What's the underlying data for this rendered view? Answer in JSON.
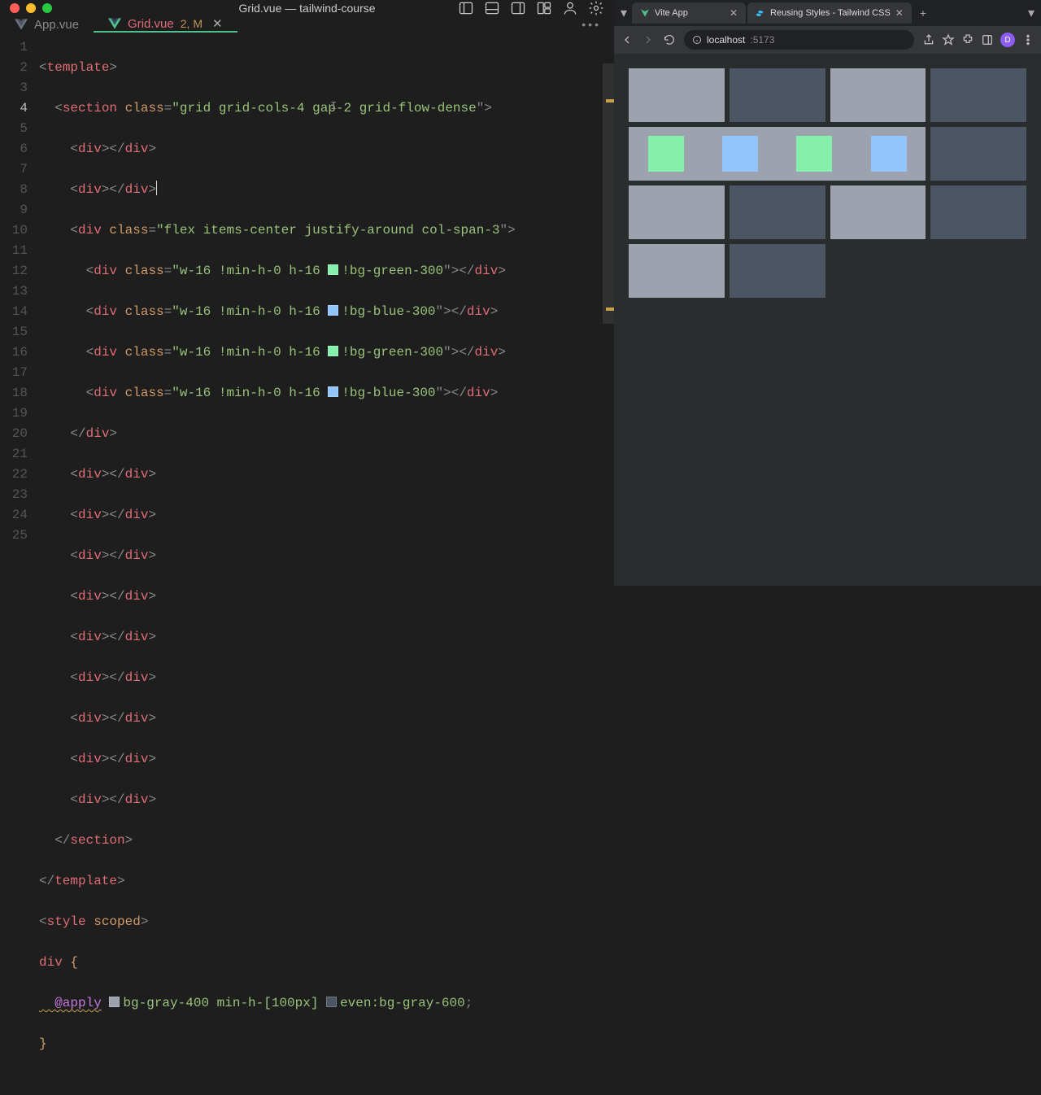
{
  "window_title": "Grid.vue — tailwind-course",
  "editor_tabs": [
    {
      "name": "App.vue",
      "active": false,
      "meta": "",
      "close": false
    },
    {
      "name": "Grid.vue",
      "active": true,
      "meta": "2, M",
      "close": true
    }
  ],
  "line_numbers": [
    1,
    2,
    3,
    4,
    5,
    6,
    7,
    8,
    9,
    10,
    11,
    12,
    13,
    14,
    15,
    16,
    17,
    18,
    19,
    20,
    21,
    22,
    23,
    24,
    25
  ],
  "active_line": 4,
  "code": {
    "l1": {
      "p1": "<",
      "p2": "template",
      "p3": ">"
    },
    "l2": {
      "p1": "  <",
      "p2": "section",
      "attr": " class",
      "eq": "=",
      "q": "\"",
      "val": "grid grid-cols-4 gap-2 grid-flow-dense",
      "end": "\">"
    },
    "l3": {
      "open": "    <",
      "tag": "div",
      "mid": "></",
      "close": ">"
    },
    "l4": {
      "open": "    <",
      "tag": "div",
      "mid": "></",
      "close": ">"
    },
    "l5": {
      "open": "    <",
      "tag": "div",
      "attr": " class",
      "eq": "=",
      "q": "\"",
      "val": "flex items-center justify-around col-span-3",
      "end": "\">"
    },
    "l6": {
      "open": "      <",
      "tag": "div",
      "attr": " class",
      "eq": "=",
      "q": "\"",
      "val1": "w-16 !min-h-0 h-16 ",
      "chip": "#86efac",
      "val2": "!bg-green-300",
      "end": "\"></",
      "close": ">"
    },
    "l7": {
      "open": "      <",
      "tag": "div",
      "attr": " class",
      "eq": "=",
      "q": "\"",
      "val1": "w-16 !min-h-0 h-16 ",
      "chip": "#93c5fd",
      "val2": "!bg-blue-300",
      "end": "\"></",
      "close": ">"
    },
    "l8": {
      "open": "      <",
      "tag": "div",
      "attr": " class",
      "eq": "=",
      "q": "\"",
      "val1": "w-16 !min-h-0 h-16 ",
      "chip": "#86efac",
      "val2": "!bg-green-300",
      "end": "\"></",
      "close": ">"
    },
    "l9": {
      "open": "      <",
      "tag": "div",
      "attr": " class",
      "eq": "=",
      "q": "\"",
      "val1": "w-16 !min-h-0 h-16 ",
      "chip": "#93c5fd",
      "val2": "!bg-blue-300",
      "end": "\"></",
      "close": ">"
    },
    "l10": {
      "open": "    </",
      "tag": "div",
      "close": ">"
    },
    "l11": {
      "open": "    <",
      "tag": "div",
      "mid": "></",
      "close": ">"
    },
    "l12": {
      "open": "    <",
      "tag": "div",
      "mid": "></",
      "close": ">"
    },
    "l13": {
      "open": "    <",
      "tag": "div",
      "mid": "></",
      "close": ">"
    },
    "l14": {
      "open": "    <",
      "tag": "div",
      "mid": "></",
      "close": ">"
    },
    "l15": {
      "open": "    <",
      "tag": "div",
      "mid": "></",
      "close": ">"
    },
    "l16": {
      "open": "    <",
      "tag": "div",
      "mid": "></",
      "close": ">"
    },
    "l17": {
      "open": "    <",
      "tag": "div",
      "mid": "></",
      "close": ">"
    },
    "l18": {
      "open": "    <",
      "tag": "div",
      "mid": "></",
      "close": ">"
    },
    "l19": {
      "open": "    <",
      "tag": "div",
      "mid": "></",
      "close": ">"
    },
    "l20": {
      "open": "  </",
      "tag": "section",
      "close": ">"
    },
    "l21": {
      "open": "</",
      "tag": "template",
      "close": ">"
    },
    "l22": {
      "open": "<",
      "tag": "style",
      "attr": " scoped",
      "close": ">"
    },
    "l23": {
      "sel": "div ",
      "brace": "{"
    },
    "l24": {
      "apply": "  @apply",
      "sp": " ",
      "chip1": "#9ca3af",
      "v1": "bg-gray-400 min-h-[100px]",
      "sp2": " ",
      "chip2": "#4b5563",
      "v2": "even:bg-gray-600",
      "semi": ";"
    },
    "l25": {
      "brace": "}"
    }
  },
  "browser": {
    "tabs": [
      {
        "title": "Vite App",
        "icon": "vite"
      },
      {
        "title": "Reusing Styles - Tailwind CSS",
        "icon": "tailwind"
      }
    ],
    "url_host": "localhost",
    "url_port": ":5173",
    "avatar_letter": "D"
  },
  "colors": {
    "green300": "#86efac",
    "blue300": "#93c5fd",
    "gray400": "#9ca3af",
    "gray600": "#4b5563"
  }
}
